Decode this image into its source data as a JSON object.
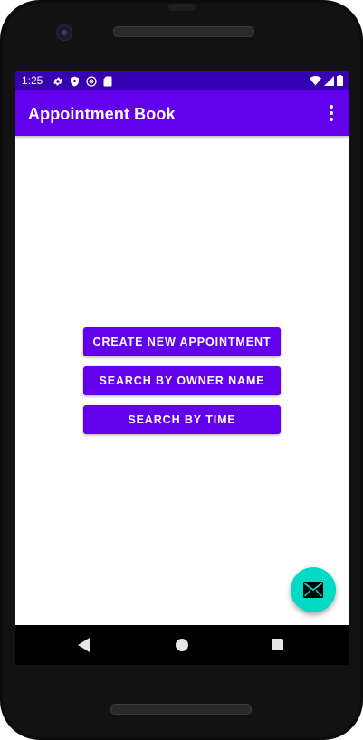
{
  "status_bar": {
    "time": "1:25",
    "left_icons": [
      "settings-gear-icon",
      "shield-icon",
      "sync-circle-icon",
      "sd-card-icon"
    ],
    "right_icons": [
      "wifi-icon",
      "cell-signal-icon",
      "battery-icon"
    ]
  },
  "app_bar": {
    "title": "Appointment Book",
    "menu_icon": "more-vert-icon"
  },
  "main": {
    "buttons": [
      {
        "label": "CREATE NEW APPOINTMENT"
      },
      {
        "label": "SEARCH BY OWNER NAME"
      },
      {
        "label": "SEARCH BY TIME"
      }
    ]
  },
  "fab": {
    "icon": "email-icon"
  },
  "navigation": {
    "icons": [
      "back-icon",
      "home-icon",
      "recents-icon"
    ]
  },
  "colors": {
    "status_bar": "#3700b3",
    "primary": "#6200ee",
    "accent": "#03dac5"
  }
}
